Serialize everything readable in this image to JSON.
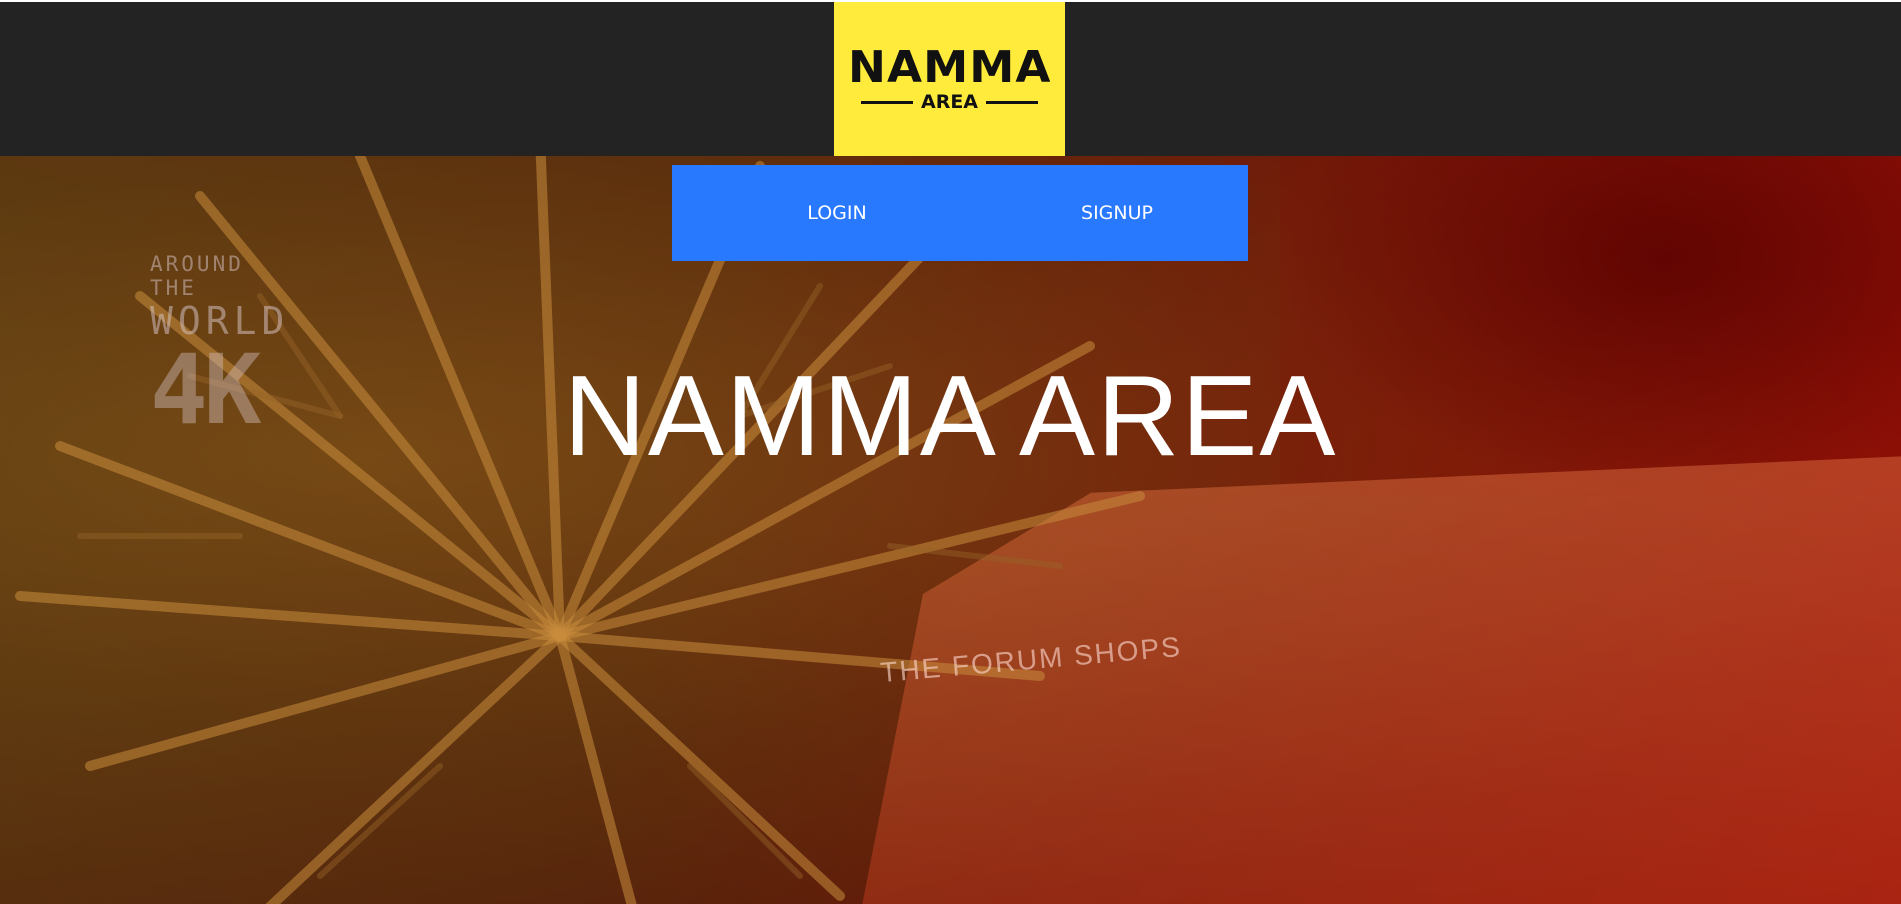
{
  "header": {
    "logo_title": "NAMMA",
    "logo_subtitle": "AREA"
  },
  "nav": {
    "login_label": "LOGIN",
    "signup_label": "SIGNUP"
  },
  "hero": {
    "title": "NAMMA AREA",
    "watermark_line1": "AROUND THE",
    "watermark_line2": "WORLD",
    "watermark_line3": "4K",
    "sign_text": "THE FORUM SHOPS"
  },
  "colors": {
    "header_bg": "#232323",
    "logo_bg": "#ffeb3b",
    "nav_bg": "#2979ff",
    "hero_accent": "#c0100a"
  }
}
